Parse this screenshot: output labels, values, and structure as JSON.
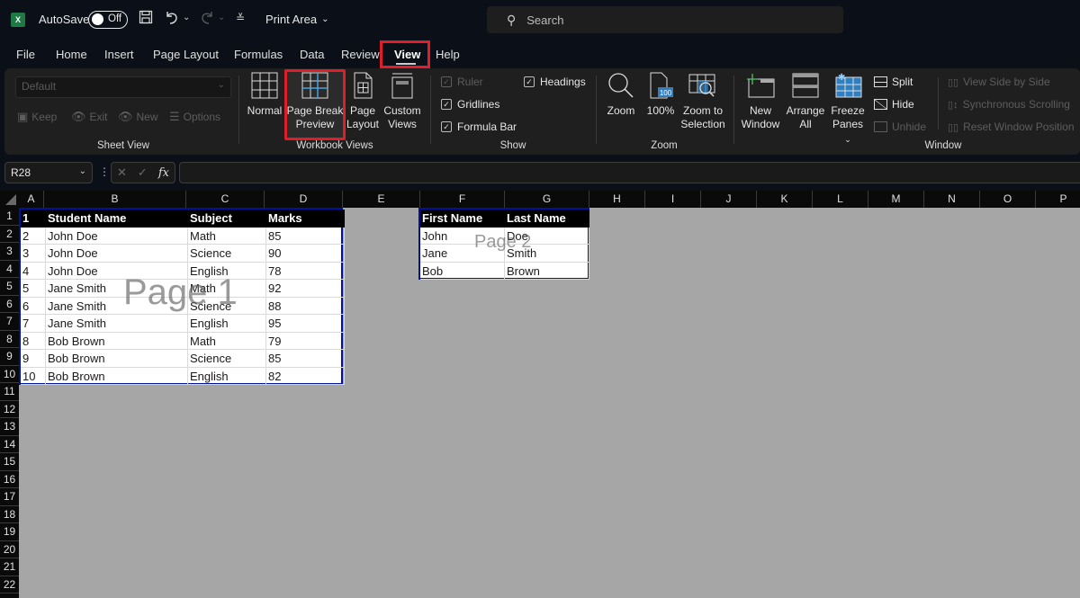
{
  "titlebar": {
    "app_icon": "excel-icon",
    "autosave_label": "AutoSave",
    "autosave_state": "Off",
    "print_area_label": "Print Area",
    "search_placeholder": "Search"
  },
  "menu": {
    "items": [
      "File",
      "Home",
      "Insert",
      "Page Layout",
      "Formulas",
      "Data",
      "Review",
      "View",
      "Help"
    ],
    "active": "View"
  },
  "ribbon": {
    "sheet_view": {
      "group_label": "Sheet View",
      "dropdown_value": "Default",
      "keep": "Keep",
      "exit": "Exit",
      "new": "New",
      "options": "Options"
    },
    "workbook_views": {
      "group_label": "Workbook Views",
      "normal": "Normal",
      "page_break_1": "Page Break",
      "page_break_2": "Preview",
      "page_layout_1": "Page",
      "page_layout_2": "Layout",
      "custom_1": "Custom",
      "custom_2": "Views"
    },
    "show": {
      "group_label": "Show",
      "ruler": "Ruler",
      "gridlines": "Gridlines",
      "formula_bar": "Formula Bar",
      "headings": "Headings"
    },
    "zoom": {
      "group_label": "Zoom",
      "zoom": "Zoom",
      "hundred": "100%",
      "zoom_sel_1": "Zoom to",
      "zoom_sel_2": "Selection"
    },
    "window": {
      "group_label": "Window",
      "new_window_1": "New",
      "new_window_2": "Window",
      "arrange_1": "Arrange",
      "arrange_2": "All",
      "freeze_1": "Freeze",
      "freeze_2": "Panes",
      "split": "Split",
      "hide": "Hide",
      "unhide": "Unhide",
      "side_by_side": "View Side by Side",
      "sync_scroll": "Synchronous Scrolling",
      "reset_pos": "Reset Window Position"
    }
  },
  "formula_bar": {
    "name_box": "R28",
    "formula": ""
  },
  "columns": [
    "A",
    "B",
    "C",
    "D",
    "E",
    "F",
    "G",
    "H",
    "I",
    "J",
    "K",
    "L",
    "M",
    "N",
    "O",
    "P"
  ],
  "rows": [
    "1",
    "2",
    "3",
    "4",
    "5",
    "6",
    "7",
    "8",
    "9",
    "10",
    "11",
    "12",
    "13",
    "14",
    "15",
    "16",
    "17",
    "18",
    "19",
    "20",
    "21",
    "22"
  ],
  "page1": {
    "watermark": "Page 1",
    "header": [
      "1",
      "Student Name",
      "Subject",
      "Marks"
    ],
    "rows": [
      [
        "2",
        "John Doe",
        "Math",
        "85"
      ],
      [
        "3",
        "John Doe",
        "Science",
        "90"
      ],
      [
        "4",
        "John Doe",
        "English",
        "78"
      ],
      [
        "5",
        "Jane Smith",
        "Math",
        "92"
      ],
      [
        "6",
        "Jane Smith",
        "Science",
        "88"
      ],
      [
        "7",
        "Jane Smith",
        "English",
        "95"
      ],
      [
        "8",
        "Bob Brown",
        "Math",
        "79"
      ],
      [
        "9",
        "Bob Brown",
        "Science",
        "85"
      ],
      [
        "10",
        "Bob Brown",
        "English",
        "82"
      ]
    ]
  },
  "page2": {
    "watermark": "Page 2",
    "header": [
      "First Name",
      "Last Name"
    ],
    "rows": [
      [
        "John",
        "Doe"
      ],
      [
        "Jane",
        "Smith"
      ],
      [
        "Bob",
        "Brown"
      ]
    ]
  },
  "colors": {
    "highlight": "#e01e2a",
    "page_border": "#00139e",
    "sheet_bg": "#a6a6a6"
  }
}
